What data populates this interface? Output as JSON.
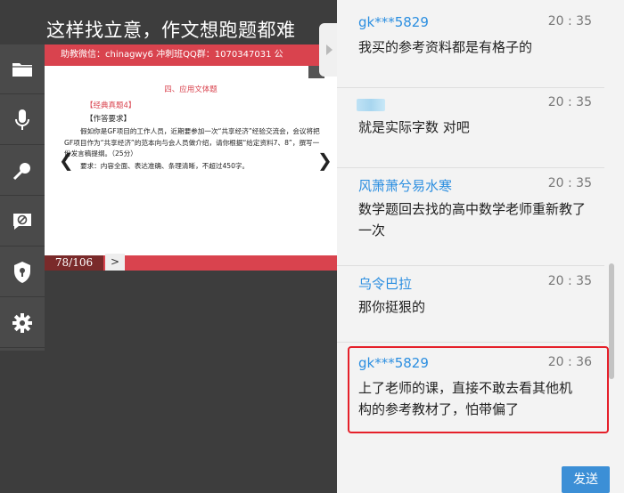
{
  "lesson": {
    "title": "这样找立意，作文想跑题都难"
  },
  "toolbar": {
    "icons": [
      "folder-icon",
      "microphone-icon",
      "handheld-mic-icon",
      "no-chat-icon",
      "shield-icon",
      "gear-icon"
    ]
  },
  "slide": {
    "banner": "助教微信：chinagwy6  冲刺班QQ群：1070347031      公",
    "section_title": "四、应用文体题",
    "case_label": "【经典真题4】",
    "answer_label": "【作答要求】",
    "paragraph": "假如你是GF项目的工作人员，近期要参加一次“共享经济”经验交流会，会议将把GF项目作为“共享经济”的范本向与会人员做介绍，请你根据“给定资料7、8”，撰写一份发言稿提纲。（25分）",
    "requirement": "要求：内容全面、表达准确、条理清晰，不超过450字。",
    "page": "78/106",
    "next_label": ">"
  },
  "chat": {
    "messages": [
      {
        "name": "gk***5829",
        "time": "20 : 35",
        "text": "我买的参考资料都是有格子的"
      },
      {
        "name": "",
        "time": "20 : 35",
        "text": "就是实际字数  对吧"
      },
      {
        "name": "风萧萧兮易水寒",
        "time": "20 : 35",
        "text": "数学题回去找的高中数学老师重新教了一次"
      },
      {
        "name": "乌令巴拉",
        "time": "20 : 35",
        "text": "那你挺狠的"
      },
      {
        "name": "gk***5829",
        "time": "20 : 36",
        "text": "上了老师的课，直接不敢去看其他机构的参考教材了，怕带偏了"
      }
    ],
    "send_label": "发送"
  },
  "colors": {
    "accent_red": "#d9434e",
    "link_blue": "#2b8ee0",
    "send_blue": "#3c8fd6",
    "highlight": "#e5202a"
  }
}
